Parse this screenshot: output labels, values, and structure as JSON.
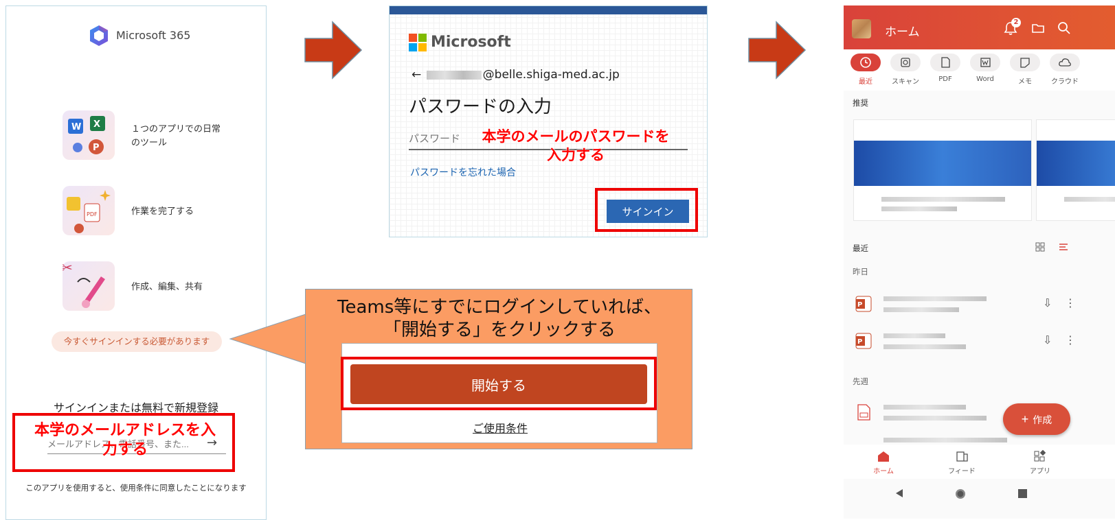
{
  "panel1": {
    "app_title": "Microsoft 365",
    "features": [
      {
        "text": "１つのアプリでの日常のツール"
      },
      {
        "text": "作業を完了する"
      },
      {
        "text": "作成、編集、共有"
      }
    ],
    "signin_required": "今すぐサインインする必要があります",
    "signup_title": "サインインまたは無料で新規登録",
    "email_placeholder": "メールアドレス、電話番号、また...",
    "terms_text": "このアプリを使用すると、使用条件に同意したことになります",
    "annotation": "本学のメールアドレスを入力する"
  },
  "panel2": {
    "brand": "Microsoft",
    "email_suffix": "@belle.shiga-med.ac.jp",
    "title": "パスワードの入力",
    "password_placeholder": "パスワード",
    "forgot_link": "パスワードを忘れた場合",
    "signin_button": "サインイン",
    "annotation_line1": "本学のメールのパスワードを",
    "annotation_line2": "入力する"
  },
  "callout": {
    "line1": "Teams等にすでにログインしていれば、",
    "line2": "「開始する」をクリックする",
    "start_button": "開始する",
    "terms_link": "ご使用条件"
  },
  "panel3": {
    "header_title": "ホーム",
    "notification_count": "2",
    "filters": [
      "最近",
      "スキャン",
      "PDF",
      "Word",
      "メモ",
      "クラウド"
    ],
    "recommended_label": "推奨",
    "recent_label": "最近",
    "yesterday_label": "昨日",
    "last_week_label": "先週",
    "create_button": "作成",
    "nav": [
      "ホーム",
      "フィード",
      "アプリ"
    ]
  },
  "colors": {
    "accent_red": "#d9423a",
    "annotation_red": "#ff0000",
    "callout_orange": "#fb9c63",
    "arrow_red": "#c83a16",
    "start_button": "#c04520",
    "signin_blue": "#2b67b3"
  }
}
